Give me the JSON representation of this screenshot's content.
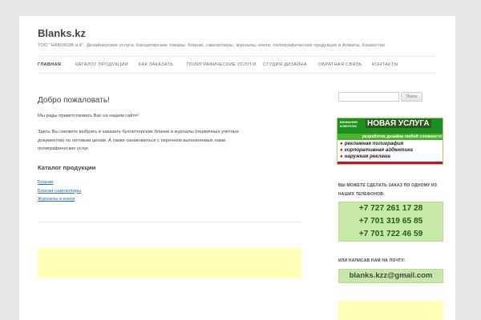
{
  "site": {
    "title": "Blanks.kz",
    "description": "ТОО \"НАБОКОВ и К\". Дизайнерские услуги. Канцелярские товары: бланки, самокопиры, журналы, книги, полиграфическая продукция в Алматы, Казахстан"
  },
  "nav": {
    "items": [
      {
        "label": "Главная",
        "active": true
      },
      {
        "label": "Каталог продукции"
      },
      {
        "label": "Как заказать"
      },
      {
        "label": "Полиграфические услуги"
      },
      {
        "label": "Студия дизайна"
      },
      {
        "label": "Обратная связь"
      },
      {
        "label": "Контакты"
      }
    ]
  },
  "main": {
    "title": "Добро пожаловать!",
    "greeting": "Мы рады приветствовать Вас на нашем сайте!",
    "intro_lines": [
      "Здесь Вы сможете выбрать и заказать бухгалтерские бланки и журналы (первичных учётных",
      "документов) по оптовым ценам. А также ознакомиться с перечнем выполняемых нами",
      "полиграфических услуг."
    ],
    "catalog_heading": "Каталог продукции",
    "catalog_links": [
      "Бланки",
      "Бланки-самокопиры",
      "Журналы и книги"
    ]
  },
  "sidebar": {
    "search_button": "Поиск",
    "search_value": "",
    "banner": {
      "note": "ВНИМАНИЮ КЛИЕНТОВ!",
      "headline": "НОВАЯ УСЛУГА",
      "subline": "разработка дизайна любой сложности",
      "services": [
        "рекламная полиграфия",
        "корпоративная айдентика",
        "наружная реклама"
      ]
    },
    "order_phone_title_lines": [
      "Вы можете сделать заказ по одному из",
      "наших телефонов:"
    ],
    "phones": [
      "+7 727 261 17 28",
      "+7 701 319 65 85",
      "+7 701 722 46 59"
    ],
    "email_title": "Или написав нам на почту:",
    "email": "blanks.kzz@gmail.com"
  },
  "colors": {
    "page_bg": "#e6e6e6",
    "link": "#21759b",
    "phone_box": "#c7e9a8",
    "ad_yellow": "#ffffb8",
    "banner_green": "#1f8f1f",
    "banner_red": "#c8102e"
  }
}
